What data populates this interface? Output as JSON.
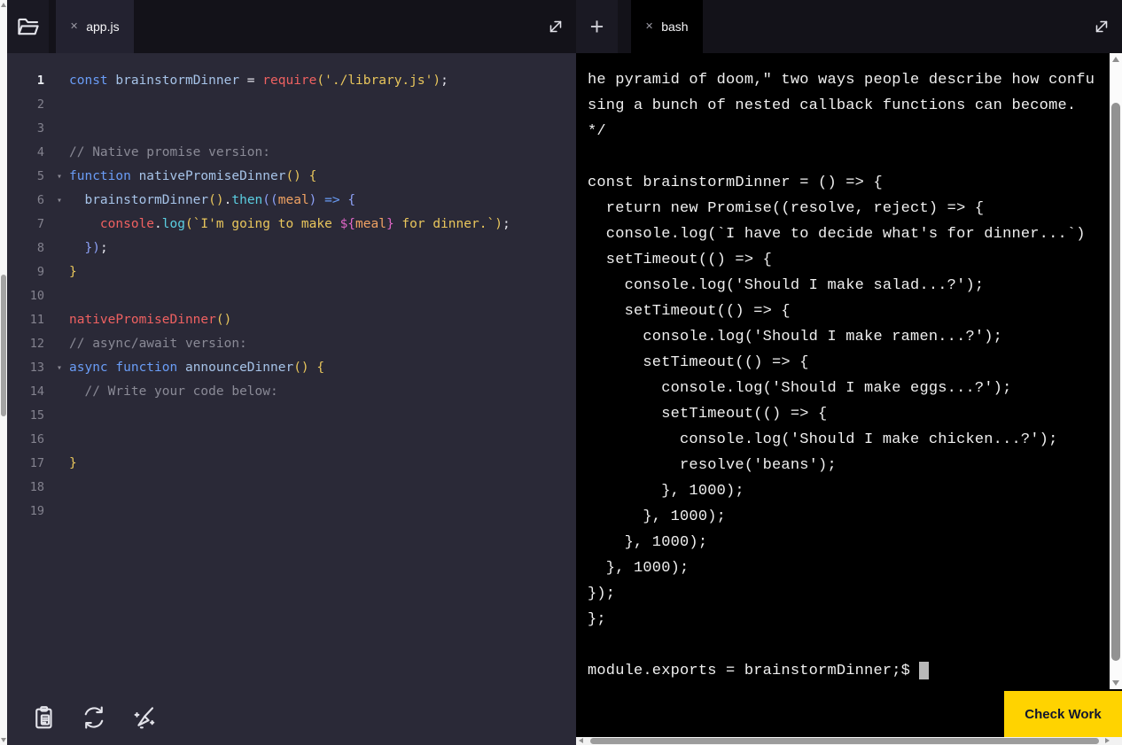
{
  "colors": {
    "accent_yellow": "#ffd300",
    "button_text": "#10162f",
    "editor_bg": "#2a2937",
    "terminal_bg": "#000000",
    "keyword_blue": "#6a9df7",
    "identifier_blue": "#a6c3e8",
    "function_red": "#ef6161",
    "method_cyan": "#5bcfe2",
    "string_yellow": "#e9c65c",
    "param_orange": "#efa263",
    "template_pink": "#dd66c5",
    "comment_gray": "#8a8a96"
  },
  "icons": {
    "close_glyph": "✕",
    "plus_glyph": "+",
    "fold_glyph": "▾"
  },
  "editor": {
    "tab_label": "app.js",
    "active_line": 1,
    "lines": [
      {
        "n": 1,
        "fold": false,
        "t": [
          [
            "kw",
            "const"
          ],
          [
            "pl",
            " "
          ],
          [
            "id",
            "brainstormDinner"
          ],
          [
            "pl",
            " = "
          ],
          [
            "fn",
            "require"
          ],
          [
            "br1",
            "("
          ],
          [
            "str",
            "'./library.js'"
          ],
          [
            "br1",
            ")"
          ],
          [
            "pl",
            ";"
          ]
        ]
      },
      {
        "n": 2,
        "fold": false,
        "t": []
      },
      {
        "n": 3,
        "fold": false,
        "t": []
      },
      {
        "n": 4,
        "fold": false,
        "t": [
          [
            "cm",
            "// Native promise version:"
          ]
        ]
      },
      {
        "n": 5,
        "fold": true,
        "t": [
          [
            "kw",
            "function"
          ],
          [
            "pl",
            " "
          ],
          [
            "id",
            "nativePromiseDinner"
          ],
          [
            "br1",
            "()"
          ],
          [
            "pl",
            " "
          ],
          [
            "br1",
            "{"
          ]
        ]
      },
      {
        "n": 6,
        "fold": true,
        "t": [
          [
            "pl",
            "  "
          ],
          [
            "id",
            "brainstormDinner"
          ],
          [
            "br1",
            "()"
          ],
          [
            "pl",
            "."
          ],
          [
            "meth",
            "then"
          ],
          [
            "br2",
            "(("
          ],
          [
            "arg",
            "meal"
          ],
          [
            "br2",
            ")"
          ],
          [
            "pl",
            " "
          ],
          [
            "kw",
            "=>"
          ],
          [
            "pl",
            " "
          ],
          [
            "br2",
            "{"
          ]
        ]
      },
      {
        "n": 7,
        "fold": false,
        "t": [
          [
            "pl",
            "    "
          ],
          [
            "fn",
            "console"
          ],
          [
            "pl",
            "."
          ],
          [
            "meth",
            "log"
          ],
          [
            "br1",
            "("
          ],
          [
            "str",
            "`I'm going to make "
          ],
          [
            "tpl",
            "${"
          ],
          [
            "arg",
            "meal"
          ],
          [
            "tpl",
            "}"
          ],
          [
            "str",
            " for dinner.`"
          ],
          [
            "br1",
            ")"
          ],
          [
            "pl",
            ";"
          ]
        ]
      },
      {
        "n": 8,
        "fold": false,
        "t": [
          [
            "pl",
            "  "
          ],
          [
            "br2",
            "})"
          ],
          [
            "pl",
            ";"
          ]
        ]
      },
      {
        "n": 9,
        "fold": false,
        "t": [
          [
            "br1",
            "}"
          ]
        ]
      },
      {
        "n": 10,
        "fold": false,
        "t": []
      },
      {
        "n": 11,
        "fold": false,
        "t": [
          [
            "fn",
            "nativePromiseDinner"
          ],
          [
            "br1",
            "()"
          ]
        ]
      },
      {
        "n": 12,
        "fold": false,
        "t": [
          [
            "cm",
            "// async/await version:"
          ]
        ]
      },
      {
        "n": 13,
        "fold": true,
        "t": [
          [
            "kw",
            "async"
          ],
          [
            "pl",
            " "
          ],
          [
            "kw",
            "function"
          ],
          [
            "pl",
            " "
          ],
          [
            "id",
            "announceDinner"
          ],
          [
            "br1",
            "()"
          ],
          [
            "pl",
            " "
          ],
          [
            "br1",
            "{"
          ]
        ]
      },
      {
        "n": 14,
        "fold": false,
        "t": [
          [
            "pl",
            "  "
          ],
          [
            "cm",
            "// Write your code below:"
          ]
        ]
      },
      {
        "n": 15,
        "fold": false,
        "t": []
      },
      {
        "n": 16,
        "fold": false,
        "t": []
      },
      {
        "n": 17,
        "fold": false,
        "t": [
          [
            "br1",
            "}"
          ]
        ]
      },
      {
        "n": 18,
        "fold": false,
        "t": []
      },
      {
        "n": 19,
        "fold": false,
        "t": []
      }
    ]
  },
  "terminal": {
    "tab_label": "bash",
    "lines": [
      "he pyramid of doom,\" two ways people describe how confu",
      "sing a bunch of nested callback functions can become.",
      "*/",
      "",
      "const brainstormDinner = () => {",
      "  return new Promise((resolve, reject) => {",
      "  console.log(`I have to decide what's for dinner...`)",
      "  setTimeout(() => {",
      "    console.log('Should I make salad...?');",
      "    setTimeout(() => {",
      "      console.log('Should I make ramen...?');",
      "      setTimeout(() => {",
      "        console.log('Should I make eggs...?');",
      "        setTimeout(() => {",
      "          console.log('Should I make chicken...?');",
      "          resolve('beans');",
      "        }, 1000);",
      "      }, 1000);",
      "    }, 1000);",
      "  }, 1000);",
      "});",
      "};",
      ""
    ],
    "prompt_line": "module.exports = brainstormDinner;$ "
  },
  "footer": {
    "check_work_label": "Check Work"
  }
}
